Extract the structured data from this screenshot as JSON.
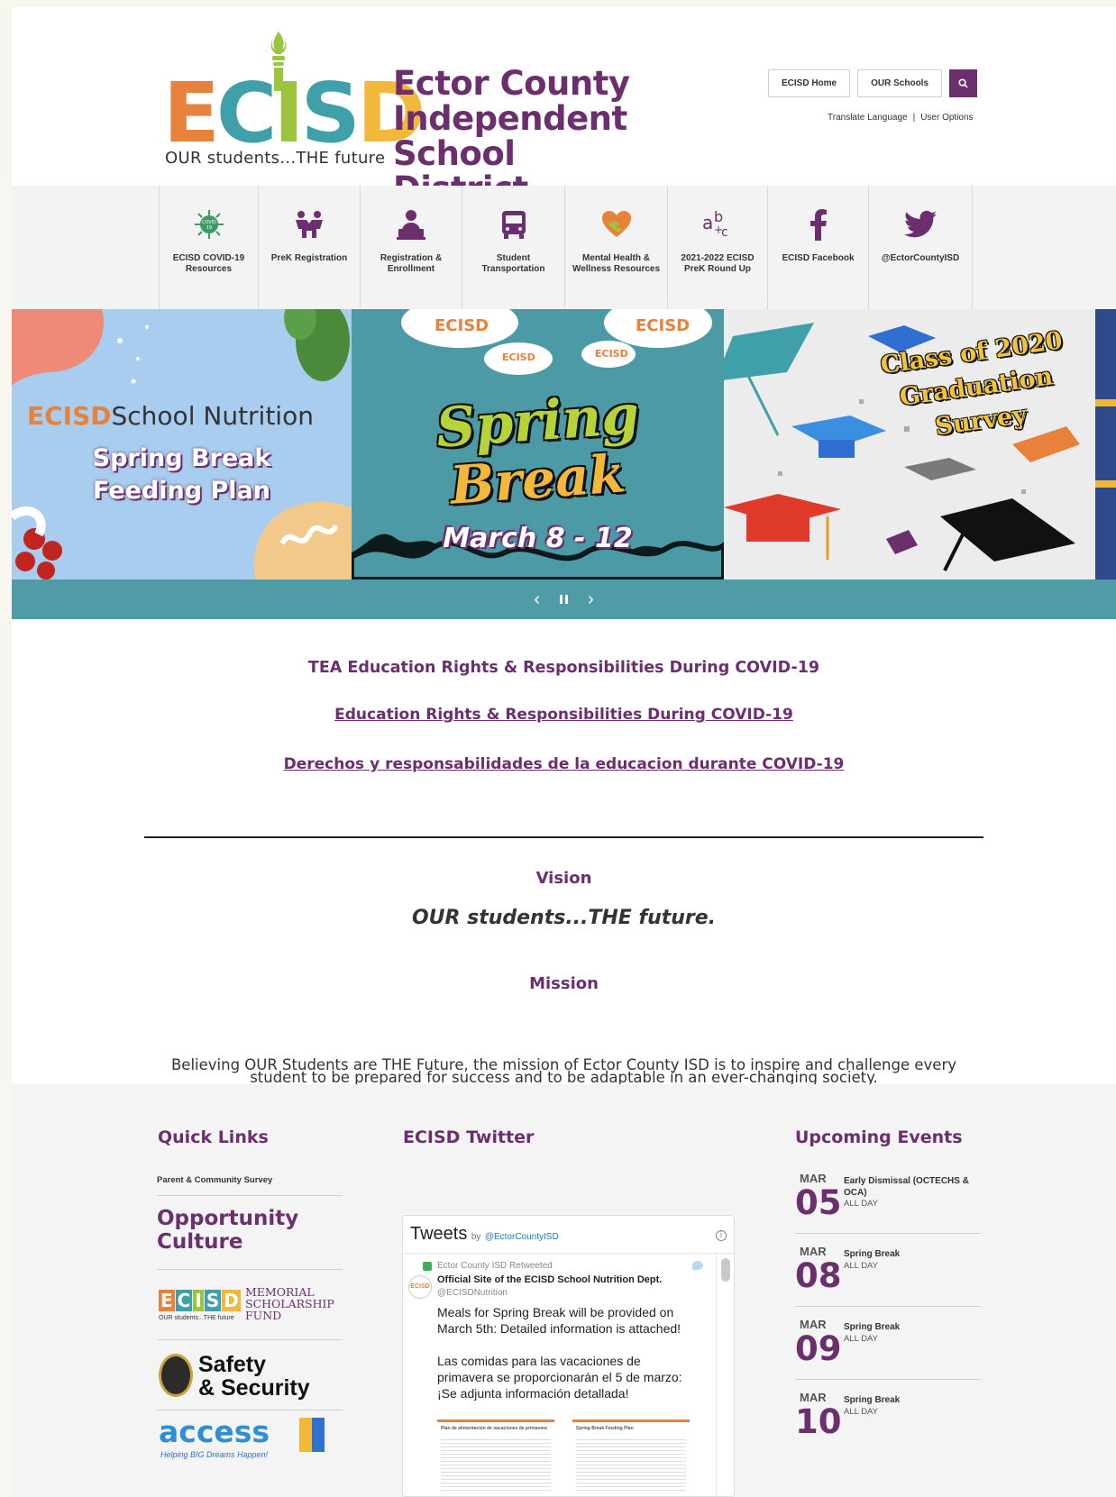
{
  "header": {
    "logo_letters": [
      "E",
      "C",
      "I",
      "S",
      "D"
    ],
    "logo_tagline": "OUR students...THE future",
    "district_name": [
      "Ector County",
      "Independent",
      "School District"
    ],
    "buttons": {
      "home": "ECISD Home",
      "schools": "OUR Schools"
    },
    "search_icon": "search-icon",
    "util_links": {
      "translate": "Translate Language",
      "separator": "|",
      "user_options": "User Options"
    }
  },
  "quick_icons": [
    {
      "label": "ECISD COVID-19 Resources",
      "icon": "covid-icon"
    },
    {
      "label": "PreK Registration",
      "icon": "children-icon"
    },
    {
      "label": "Registration & Enrollment",
      "icon": "laptop-user-icon"
    },
    {
      "label": "Student Transportation",
      "icon": "bus-icon"
    },
    {
      "label": "Mental Health & Wellness Resources",
      "icon": "heart-hands-icon"
    },
    {
      "label": "2021-2022 ECISD PreK Round Up",
      "icon": "abc-icon"
    },
    {
      "label": "ECISD Facebook",
      "icon": "facebook-icon"
    },
    {
      "label": "@EctorCountyISD",
      "icon": "twitter-icon"
    }
  ],
  "carousel": {
    "slide1": {
      "brand": "ECISD",
      "brand_suffix": "School Nutrition",
      "line1": "Spring Break",
      "line2": "Feeding Plan"
    },
    "slide2": {
      "cloud_text": "ECISD",
      "line1": "Spring",
      "line2": "Break",
      "dates": "March 8 - 12"
    },
    "slide3": {
      "line1": "Class of 2020",
      "line2": "Graduation",
      "line3": "Survey"
    },
    "controls": {
      "prev": "‹",
      "pause": "⏸",
      "next": "›"
    }
  },
  "main": {
    "covid_heading": "TEA Education Rights & Responsibilities During COVID-19",
    "link_en": "Education Rights & Responsibilities During COVID-19",
    "link_es": "Derechos y responsabilidades de la educacion durante COVID-19",
    "vision_heading": "Vision",
    "vision_text": "OUR students...THE future.",
    "mission_heading": "Mission",
    "mission_text": "Believing OUR Students are THE Future, the mission of Ector County ISD is to inspire and challenge every student to be prepared for success and to be adaptable in an ever-changing society."
  },
  "footer": {
    "quick_links": {
      "title": "Quick Links",
      "survey": "Parent & Community Survey",
      "opportunity_culture": [
        "Opportunity",
        "Culture"
      ],
      "memorial": {
        "letters": [
          "E",
          "C",
          "I",
          "S",
          "D"
        ],
        "tag": "OUR students...THE future",
        "lines": [
          "MEMORIAL",
          "SCHOLARSHIP",
          "FUND"
        ]
      },
      "safety": [
        "Safety",
        "& Security"
      ],
      "access": {
        "word": "access",
        "tag": "Helping BIG Dreams Happen!"
      }
    },
    "twitter": {
      "title": "ECISD Twitter",
      "tweets_label": "Tweets",
      "by": "by",
      "handle": "@EctorCountyISD",
      "retweeted": "Ector County ISD Retweeted",
      "account": "Official Site of the ECISD School Nutrition Dept.",
      "account_handle": "@ECISDNutrition",
      "message_en": "Meals for Spring Break will be provided on March 5th: Detailed information is attached!",
      "message_es": "Las comidas para las vacaciones de primavera se proporcionarán el 5 de marzo: ¡Se adjunta información detallada!",
      "attachment_left": "Plan de alimentación de vacaciones de primavera",
      "attachment_right": "Spring Break Feeding Plan"
    },
    "events": {
      "title": "Upcoming Events",
      "items": [
        {
          "month": "MAR",
          "day": "05",
          "title": "Early Dismissal (OCTECHS & OCA)",
          "when": "ALL DAY"
        },
        {
          "month": "MAR",
          "day": "08",
          "title": "Spring Break",
          "when": "ALL DAY"
        },
        {
          "month": "MAR",
          "day": "09",
          "title": "Spring Break",
          "when": "ALL DAY"
        },
        {
          "month": "MAR",
          "day": "10",
          "title": "Spring Break",
          "when": "ALL DAY"
        }
      ]
    }
  },
  "colors": {
    "brand_purple": "#6c2f6e",
    "teal": "#4f9ca6",
    "orange": "#e8823a",
    "green": "#9cc43e",
    "yellow": "#f2b83c"
  }
}
